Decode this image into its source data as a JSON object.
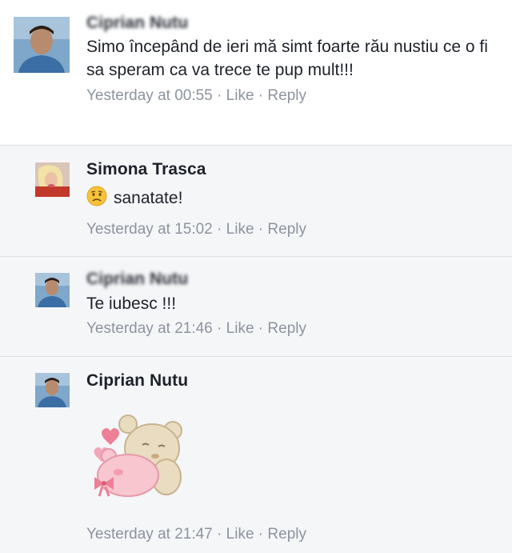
{
  "comments": [
    {
      "author": "Ciprian Nutu",
      "author_redacted": true,
      "text": "Simo începând de ieri mă simt foarte rău nustiu ce o fi sa speram ca va trece te pup mult!!!",
      "time": "Yesterday at 00:55",
      "like_label": "Like",
      "reply_label": "Reply",
      "separator": "·"
    },
    {
      "author": "Simona Trasca",
      "emoji": "worried-face-icon",
      "text": "sanatate!",
      "time": "Yesterday at 15:02",
      "like_label": "Like",
      "reply_label": "Reply",
      "separator": "·"
    },
    {
      "author": "Ciprian Nutu",
      "author_redacted": true,
      "text": "Te iubesc !!!",
      "time": "Yesterday at 21:46",
      "like_label": "Like",
      "reply_label": "Reply",
      "separator": "·"
    },
    {
      "author": "Ciprian Nutu",
      "sticker": "teddy-bears-hug-sticker",
      "time": "Yesterday at 21:47",
      "like_label": "Like",
      "reply_label": "Reply",
      "separator": "·"
    }
  ],
  "colors": {
    "meta_text": "#8d949e",
    "reply_background": "#f5f6f8",
    "divider": "#dcdee3"
  }
}
